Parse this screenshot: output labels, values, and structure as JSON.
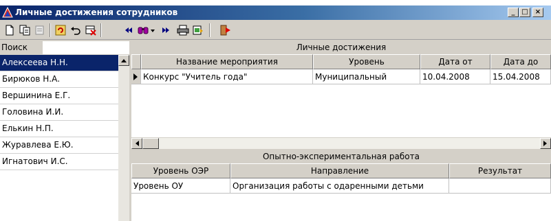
{
  "window": {
    "title": "Личные достижения сотрудников"
  },
  "title_buttons": {
    "minimize": "_",
    "maximize": "□",
    "close": "×"
  },
  "toolbar": {
    "buttons": [
      "new-document-icon",
      "copy-icon",
      "edit-icon",
      "refresh-icon",
      "undo-icon",
      "delete-icon",
      "first-record-icon",
      "find-icon",
      "find-dropdown-icon",
      "last-record-icon",
      "print-icon",
      "export-icon",
      "exit-icon"
    ]
  },
  "search": {
    "label": "Поиск",
    "value": ""
  },
  "employees": {
    "items": [
      {
        "name": "Алексеева Н.Н."
      },
      {
        "name": "Бирюков Н.А."
      },
      {
        "name": "Вершинина Е.Г."
      },
      {
        "name": "Головина И.И."
      },
      {
        "name": "Елькин Н.П."
      },
      {
        "name": "Журавлева Е.Ю."
      },
      {
        "name": "Игнатович И.С."
      }
    ],
    "selected_index": 0
  },
  "achievements": {
    "title": "Личные достижения",
    "columns": [
      "Название мероприятия",
      "Уровень",
      "Дата от",
      "Дата до"
    ],
    "rows": [
      {
        "event": "Конкурс \"Учитель года\"",
        "level": "Муниципальный",
        "date_from": "10.04.2008",
        "date_to": "15.04.2008"
      }
    ]
  },
  "experimental": {
    "title": "Опытно-экспериментальная работа",
    "columns": [
      "Уровень ОЭР",
      "Направление",
      "Результат"
    ],
    "rows": [
      {
        "level": "Уровень ОУ",
        "direction": "Организация работы с одаренными детьми",
        "result": ""
      }
    ]
  }
}
